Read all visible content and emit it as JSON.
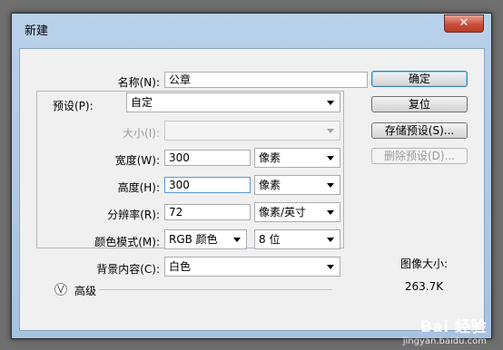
{
  "window": {
    "title": "新建",
    "close_glyph": "✕"
  },
  "form": {
    "name_label": "名称(N):",
    "name_value": "公章",
    "preset_label": "预设(P):",
    "preset_value": "自定",
    "size_label": "大小(I):",
    "size_value": "",
    "width_label": "宽度(W):",
    "width_value": "300",
    "width_unit": "像素",
    "height_label": "高度(H):",
    "height_value": "300",
    "height_unit": "像素",
    "resolution_label": "分辨率(R):",
    "resolution_value": "72",
    "resolution_unit": "像素/英寸",
    "color_mode_label": "颜色模式(M):",
    "color_mode_value": "RGB 颜色",
    "bit_depth_value": "8 位",
    "background_label": "背景内容(C):",
    "background_value": "白色",
    "advanced_label": "高级",
    "advanced_icon": "chevron-double-down-icon"
  },
  "buttons": {
    "ok": "确定",
    "reset": "复位",
    "save_preset": "存储预设(S)...",
    "delete_preset": "删除预设(D)..."
  },
  "info": {
    "image_size_label": "图像大小:",
    "image_size_value": "263.7K"
  },
  "watermark": {
    "text": "Bai 经验",
    "url": "jingyan.baidu.com"
  }
}
